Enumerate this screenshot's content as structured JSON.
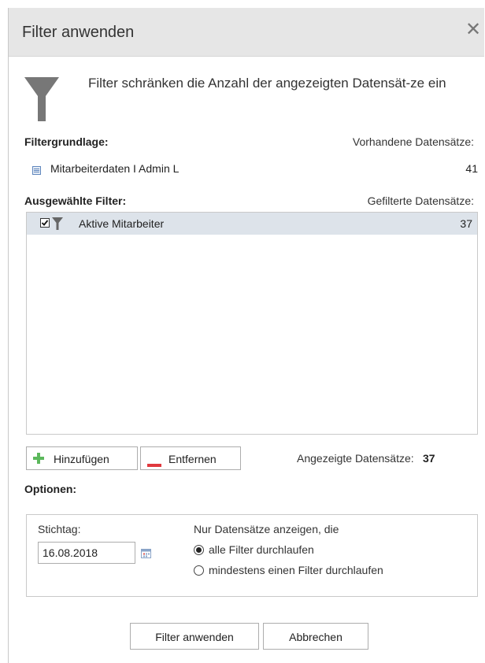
{
  "dialog": {
    "title": "Filter anwenden",
    "close_symbol": "✕"
  },
  "intro": {
    "icon": "funnel-icon",
    "text": "Filter schränken die Anzahl der angezeigten Datensät-ze ein"
  },
  "base": {
    "label": "Filtergrundlage:",
    "count_header": "Vorhandene Datensätze:",
    "item": {
      "icon": "document-icon",
      "name": "Mitarbeiterdaten I Admin L",
      "count": "41"
    }
  },
  "selected": {
    "label": "Ausgewählte Filter:",
    "count_header": "Gefilterte Datensätze:",
    "items": [
      {
        "checked": true,
        "icon": "funnel-icon",
        "name": "Aktive Mitarbeiter",
        "count": "37"
      }
    ]
  },
  "actions": {
    "add_label": "Hinzufügen",
    "remove_label": "Entfernen",
    "shown_label": "Angezeigte Datensätze:",
    "shown_value": "37"
  },
  "options": {
    "label": "Optionen:",
    "date_label": "Stichtag:",
    "date_value": "16.08.2018",
    "only_label": "Nur Datensätze anzeigen, die",
    "radio_all": "alle Filter durchlaufen",
    "radio_any": "mindestens einen Filter durchlaufen",
    "selected_radio": "all"
  },
  "footer": {
    "apply_label": "Filter anwenden",
    "cancel_label": "Abbrechen"
  },
  "colors": {
    "titlebar": "#e6e6e6",
    "selected_row": "#dde3ea",
    "plus": "#5cb85c",
    "minus": "#e0393e"
  }
}
